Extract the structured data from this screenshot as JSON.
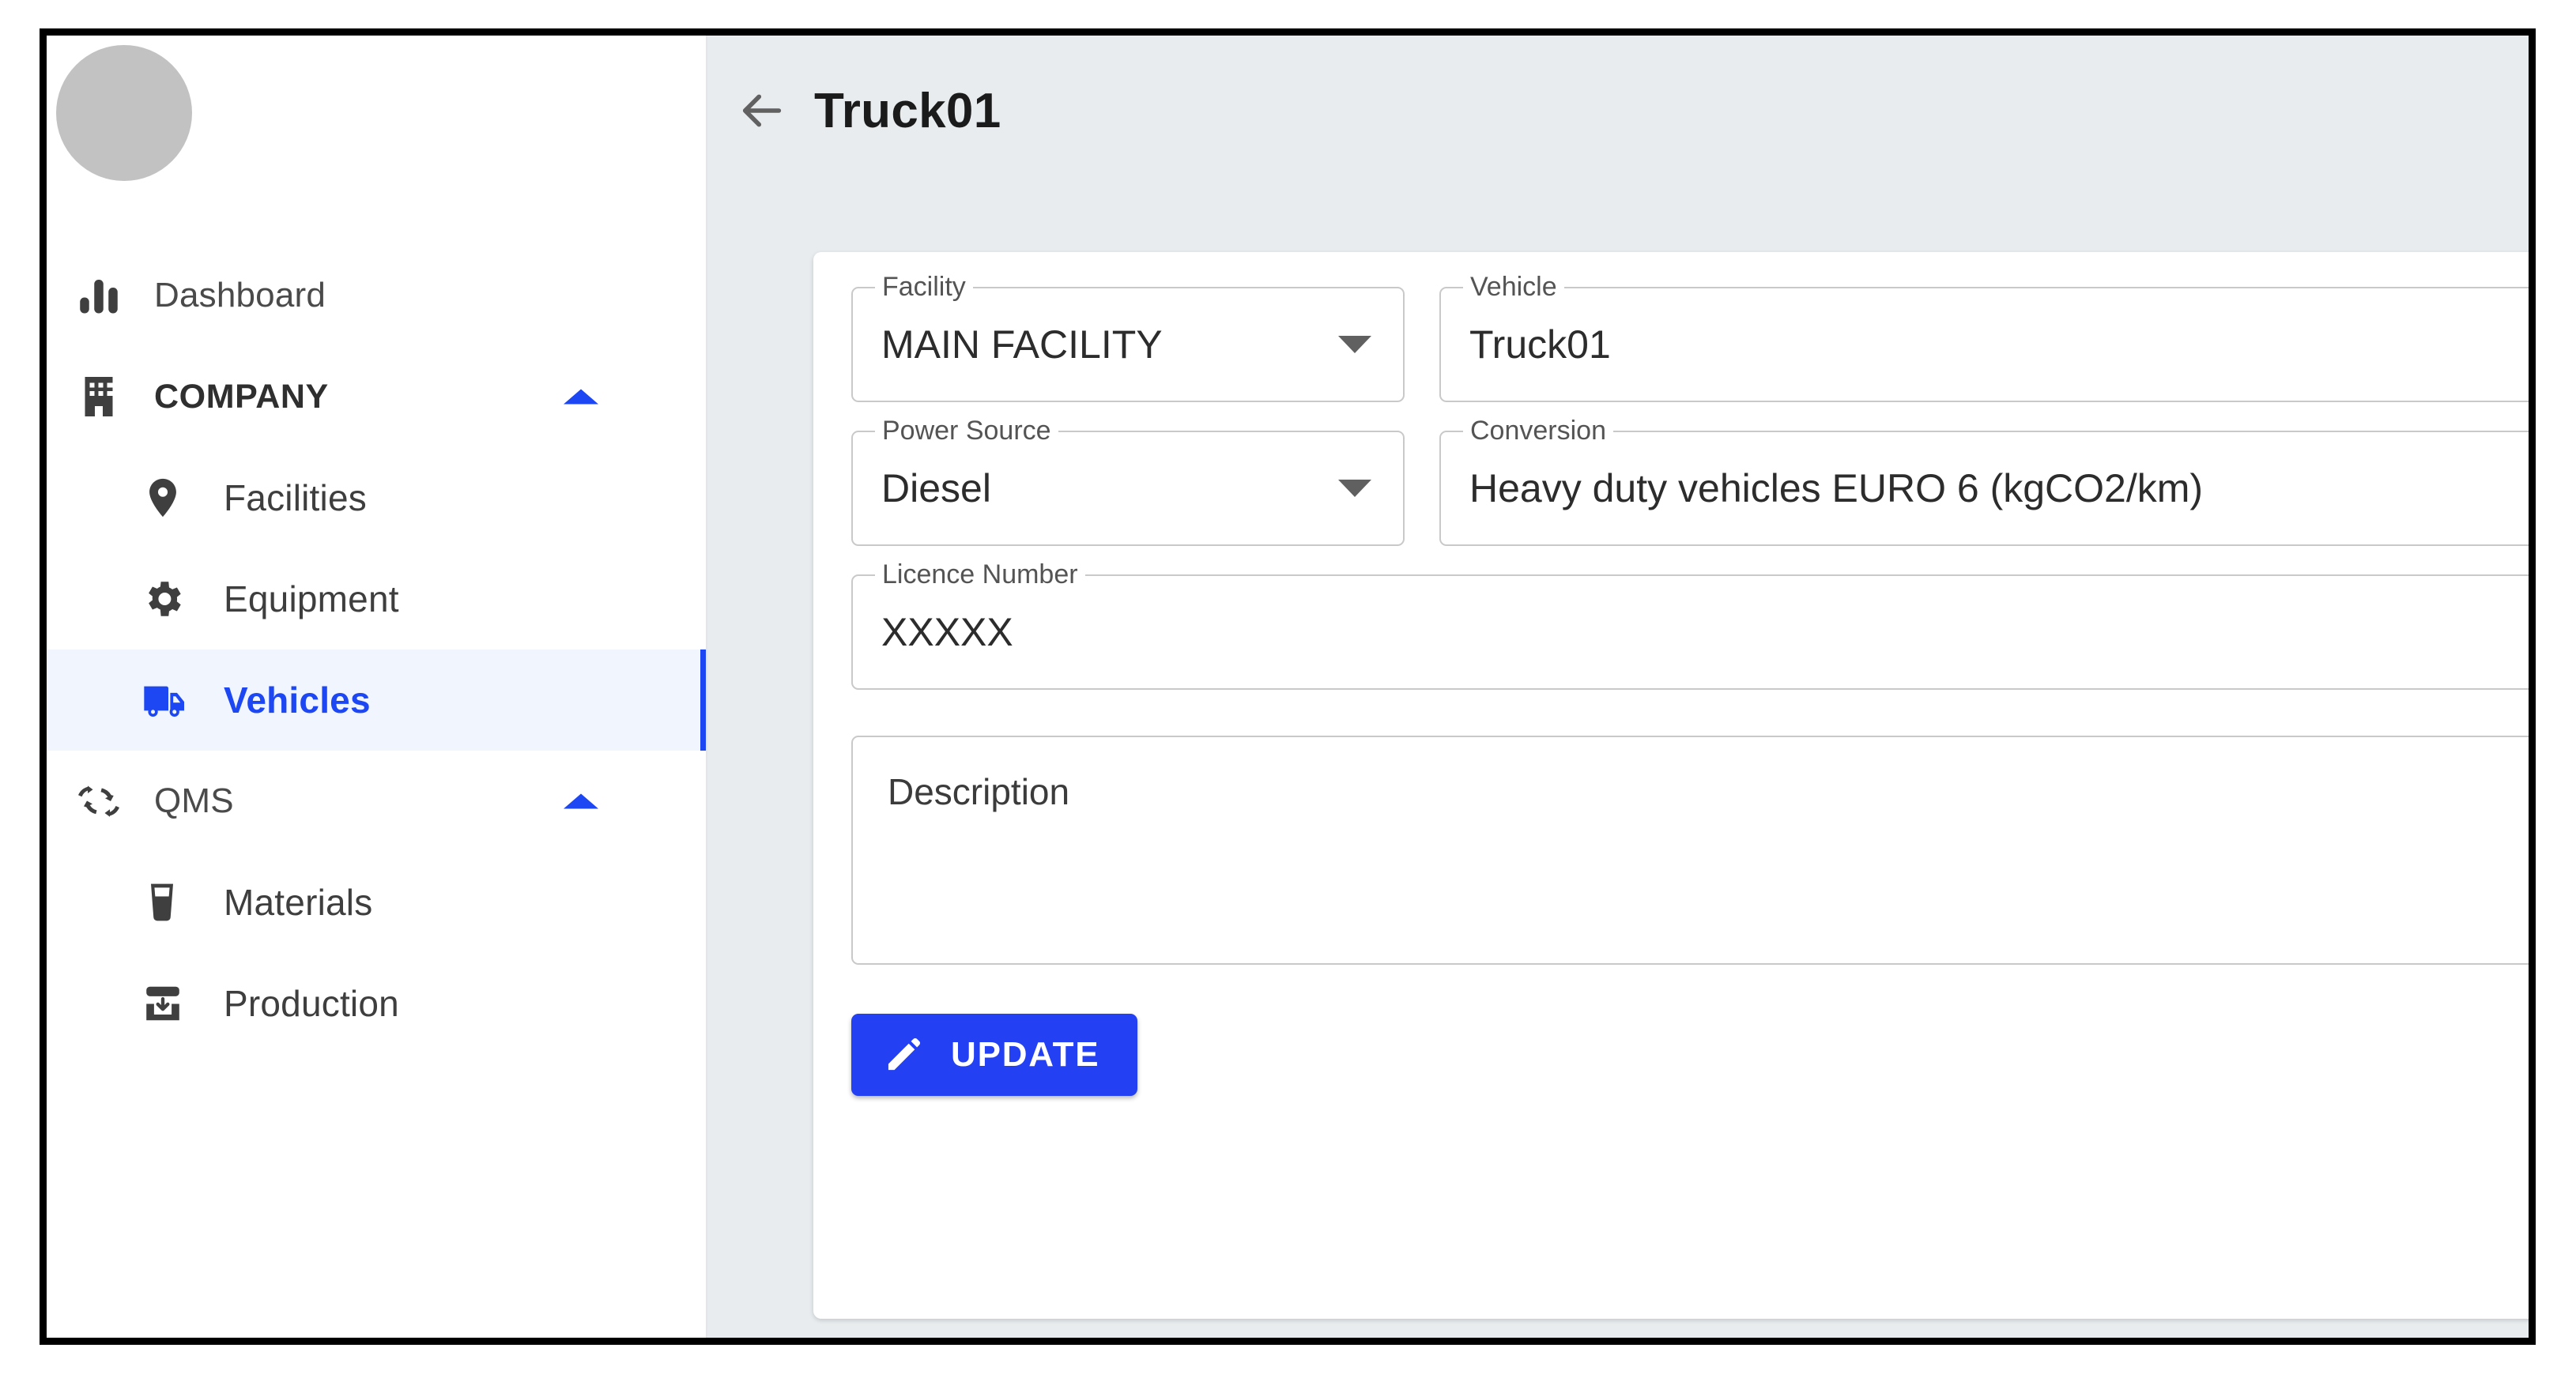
{
  "sidebar": {
    "avatar_label": "user-avatar",
    "items": [
      {
        "label": "Dashboard",
        "icon": "bar-chart-icon",
        "level": "top",
        "active": false,
        "expandable": false
      },
      {
        "label": "COMPANY",
        "icon": "building-icon",
        "level": "top",
        "active": false,
        "expandable": true,
        "group": true
      },
      {
        "label": "Facilities",
        "icon": "location-pin-icon",
        "level": "sub",
        "active": false,
        "expandable": false
      },
      {
        "label": "Equipment",
        "icon": "gear-icon",
        "level": "sub",
        "active": false,
        "expandable": false
      },
      {
        "label": "Vehicles",
        "icon": "truck-icon",
        "level": "sub",
        "active": true,
        "expandable": false
      },
      {
        "label": "QMS",
        "icon": "recycle-icon",
        "level": "top",
        "active": false,
        "expandable": true,
        "group": false
      },
      {
        "label": "Materials",
        "icon": "glass-icon",
        "level": "sub",
        "active": false,
        "expandable": false
      },
      {
        "label": "Production",
        "icon": "press-icon",
        "level": "sub",
        "active": false,
        "expandable": false
      }
    ]
  },
  "header": {
    "back_icon": "arrow-left-icon",
    "title": "Truck01"
  },
  "form": {
    "facility": {
      "label": "Facility",
      "value": "MAIN FACILITY",
      "type": "select"
    },
    "vehicle": {
      "label": "Vehicle",
      "value": "Truck01",
      "type": "text"
    },
    "power": {
      "label": "Power Source",
      "value": "Diesel",
      "type": "select"
    },
    "conversion": {
      "label": "Conversion",
      "value": "Heavy duty vehicles EURO 6 (kgCO2/km)",
      "type": "select"
    },
    "licence": {
      "label": "Licence Number",
      "value": "XXXXX",
      "type": "text"
    },
    "description": {
      "placeholder": "Description",
      "value": ""
    },
    "update_button": {
      "label": "UPDATE",
      "icon": "pencil-icon"
    }
  },
  "colors": {
    "accent": "#1c47f2",
    "button": "#2340f3",
    "active_bg": "#f1f5fe",
    "content_bg": "#e8ecef",
    "card_bg": "#ffffff",
    "field_border": "#c9c9c9"
  }
}
